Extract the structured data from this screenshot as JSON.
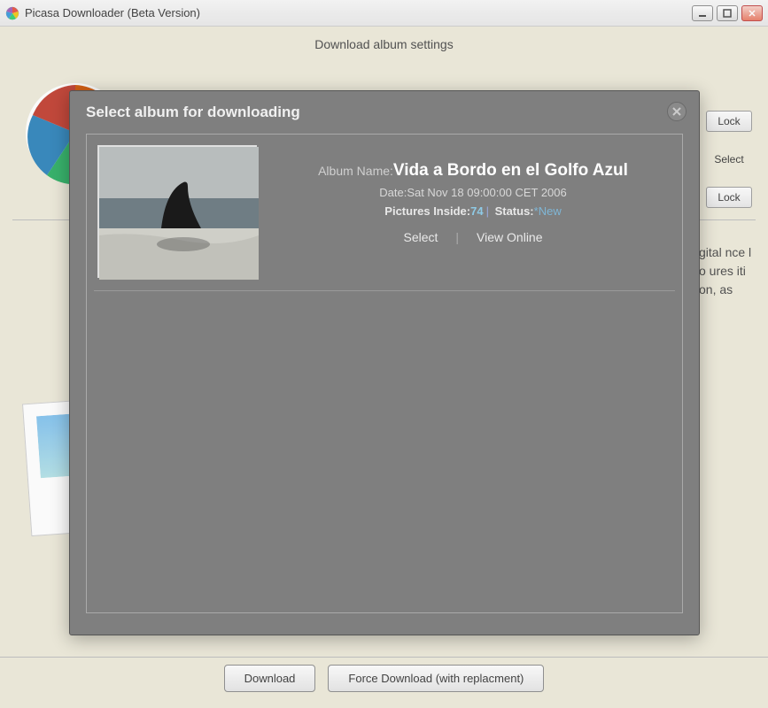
{
  "window": {
    "title": "Picasa Downloader (Beta Version)"
  },
  "main": {
    "section_title": "Download album settings",
    "side_lock1": "Lock",
    "side_select": "Select",
    "side_lock2": "Lock",
    "desc_fragment": "gital nce lo ures ition, as"
  },
  "buttons": {
    "download": "Download",
    "force": "Force Download (with replacment)"
  },
  "modal": {
    "title": "Select album for downloading",
    "album": {
      "name_label": "Album Name:",
      "name": "Vida a Bordo en el Golfo Azul",
      "date_label": "Date:",
      "date": "Sat Nov 18 09:00:00 CET 2006",
      "pictures_label": "Pictures Inside:",
      "pictures_count": "74",
      "status_label": "Status:",
      "status_value": "*New",
      "action_select": "Select",
      "action_view": "View Online"
    }
  }
}
